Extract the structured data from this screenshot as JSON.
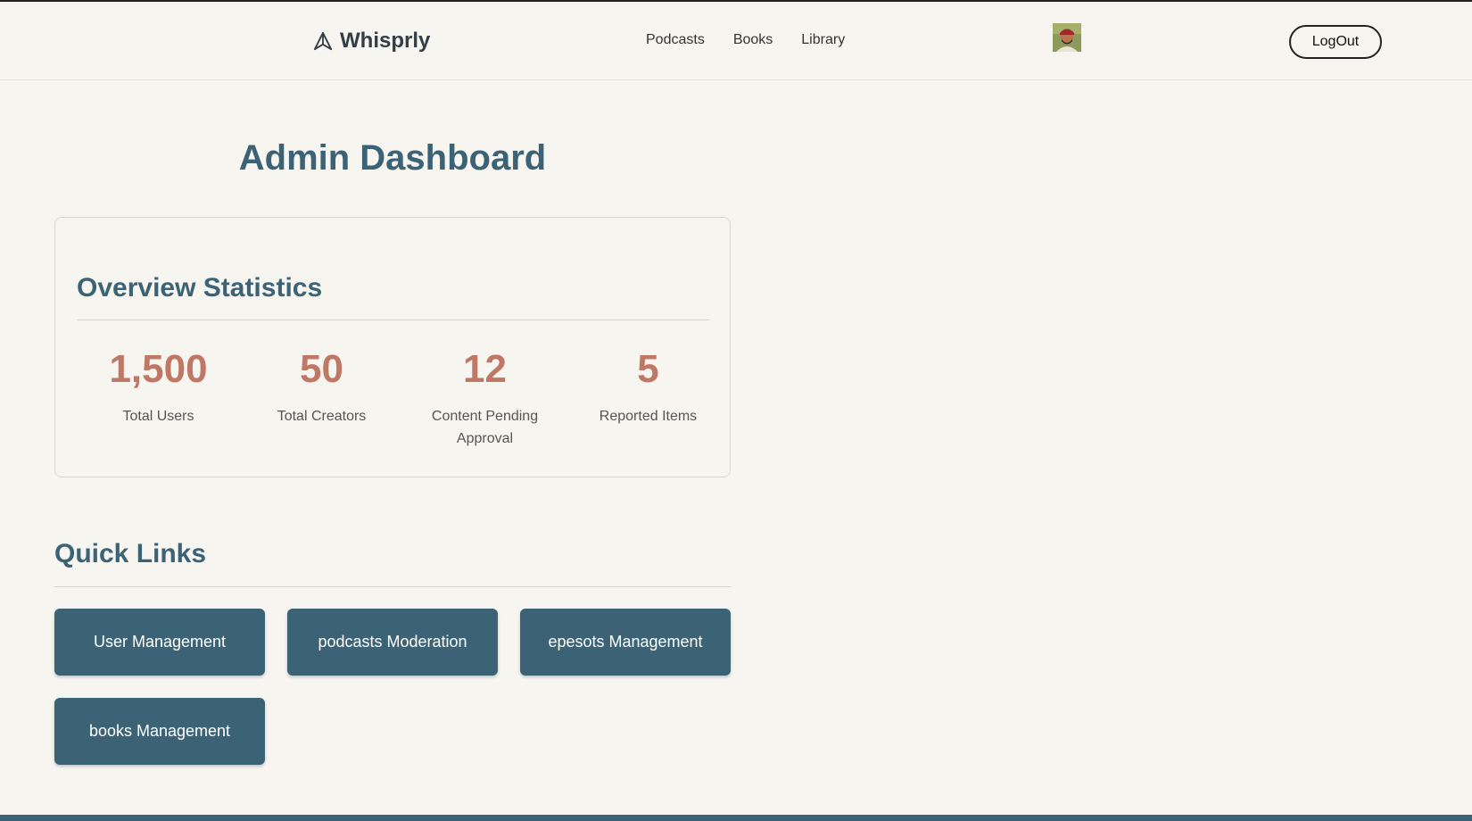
{
  "header": {
    "brand": "Whisprly",
    "nav": [
      "Podcasts",
      "Books",
      "Library"
    ],
    "logout_label": "LogOut"
  },
  "page_title": "Admin Dashboard",
  "overview": {
    "title": "Overview Statistics",
    "stats": [
      {
        "value": "1,500",
        "label": "Total Users"
      },
      {
        "value": "50",
        "label": "Total Creators"
      },
      {
        "value": "12",
        "label": "Content Pending Approval"
      },
      {
        "value": "5",
        "label": "Reported Items"
      }
    ]
  },
  "quick_links": {
    "title": "Quick Links",
    "items": [
      "User Management",
      "podcasts Moderation",
      "epesots Management",
      "books Management"
    ]
  },
  "colors": {
    "primary": "#3c6375",
    "stat_value": "#c07866",
    "background": "#f6f5f0"
  }
}
